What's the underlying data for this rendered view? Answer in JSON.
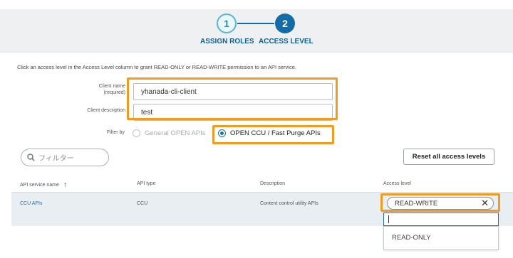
{
  "stepper": {
    "step1": {
      "number": "1",
      "label": "ASSIGN ROLES"
    },
    "step2": {
      "number": "2",
      "label": "ACCESS LEVEL"
    }
  },
  "intro_text": "Click an access level in the Access Level column to grant READ-ONLY or READ-WRITE permission to an API service.",
  "form": {
    "client_name_label_line1": "Client name",
    "client_name_label_line2": "(required)",
    "client_name_value": "yhanada-cli-client",
    "client_description_label": "Client description",
    "client_description_value": "test"
  },
  "filter": {
    "label": "Filter by",
    "options": [
      {
        "label": "General OPEN APIs",
        "selected": false
      },
      {
        "label": "OPEN CCU / Fast Purge APIs",
        "selected": true
      }
    ]
  },
  "search": {
    "placeholder": "フィルター"
  },
  "reset_button": "Reset all access levels",
  "table": {
    "headers": {
      "name": "API service name",
      "type": "API type",
      "description": "Description",
      "access": "Access level"
    },
    "rows": [
      {
        "name": "CCU APIs",
        "type": "CCU",
        "description": "Content control utility APIs",
        "access": "READ-WRITE"
      }
    ]
  },
  "dropdown": {
    "options": [
      "READ-ONLY"
    ]
  },
  "colors": {
    "highlight": "#f29c1f",
    "primary": "#146ba6",
    "link": "#2373b3"
  }
}
